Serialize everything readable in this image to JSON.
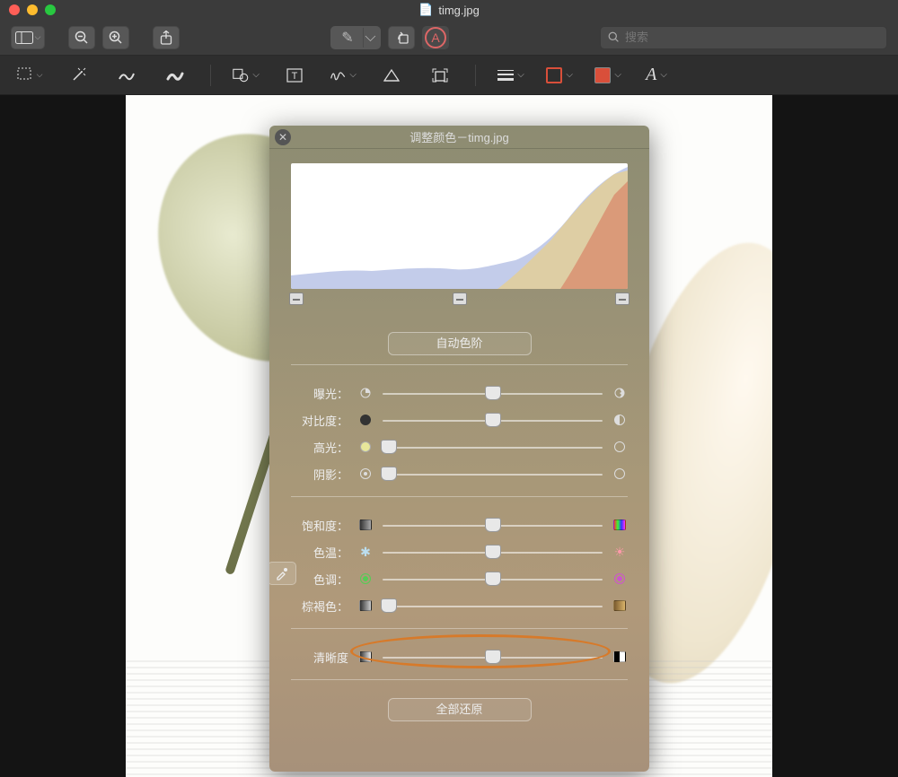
{
  "window": {
    "filename": "timg.jpg"
  },
  "search": {
    "placeholder": "搜索"
  },
  "panel": {
    "title": "调整颜色－timg.jpg",
    "auto_levels": "自动色阶",
    "reset_all": "全部还原",
    "histogram": {
      "black_point": 0,
      "mid_point": 50,
      "white_point": 100
    },
    "sliders": {
      "exposure": {
        "label": "曝光：",
        "value": 50,
        "min_pos": 0
      },
      "contrast": {
        "label": "对比度：",
        "value": 50
      },
      "highlights": {
        "label": "高光：",
        "value": 0
      },
      "shadows": {
        "label": "阴影：",
        "value": 0
      },
      "saturation": {
        "label": "饱和度：",
        "value": 50
      },
      "temperature": {
        "label": "色温：",
        "value": 50
      },
      "tint": {
        "label": "色调：",
        "value": 50
      },
      "sepia": {
        "label": "棕褐色：",
        "value": 0
      },
      "sharpness": {
        "label": "清晰度",
        "value": 50
      }
    }
  }
}
